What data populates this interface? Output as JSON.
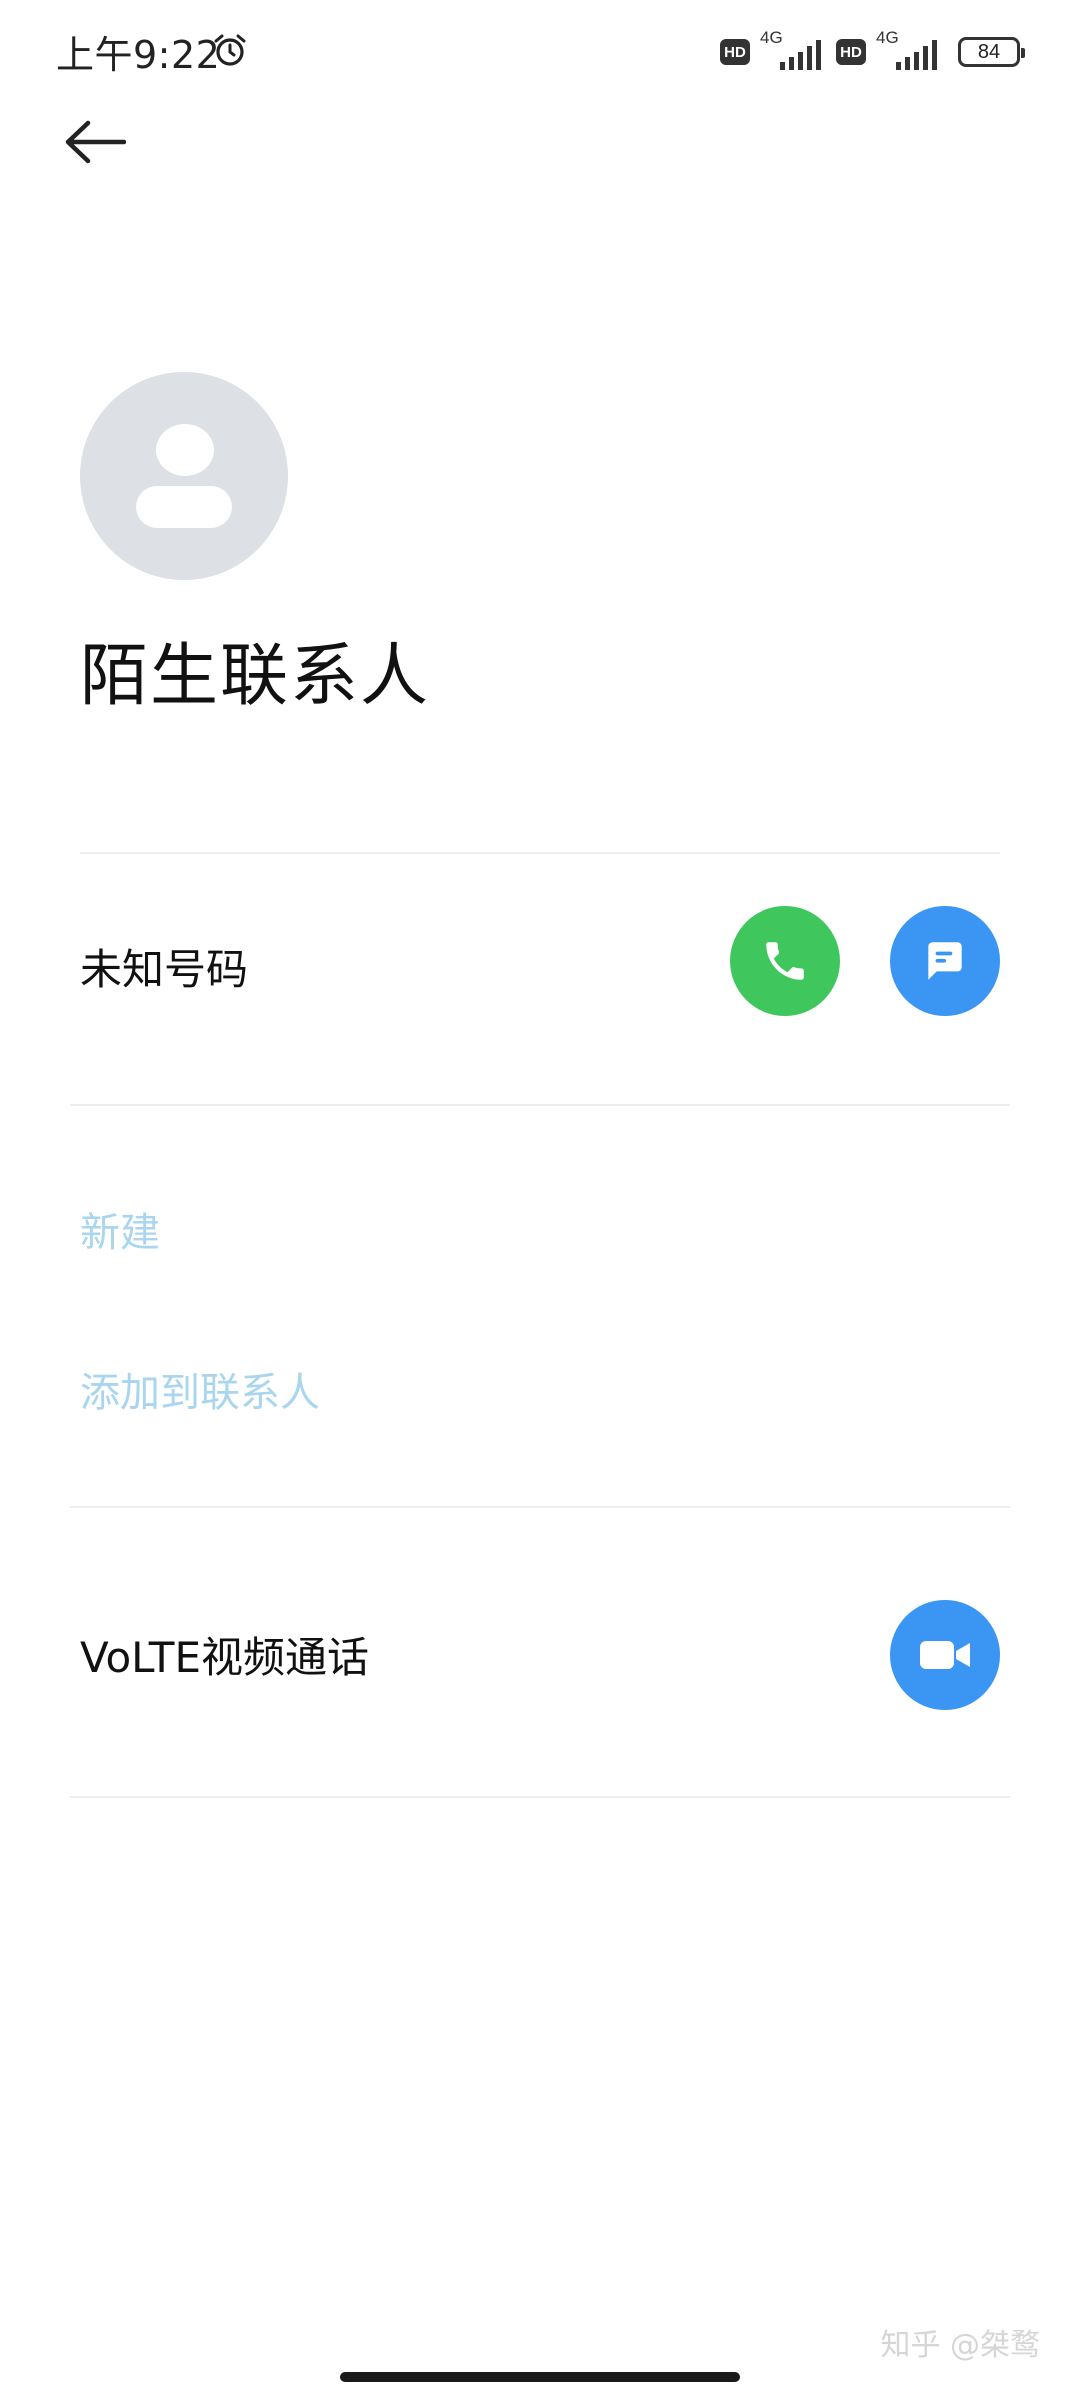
{
  "status_bar": {
    "time": "上午9:22",
    "hd_label": "HD",
    "sim1_network": "4G",
    "sim2_network": "4G",
    "battery": "84",
    "icons": [
      "alarm-icon",
      "signal-icon",
      "battery-icon"
    ]
  },
  "header": {
    "back_icon": "back-arrow-icon"
  },
  "contact": {
    "avatar_icon": "person-placeholder-icon",
    "name": "陌生联系人"
  },
  "number_row": {
    "label": "未知号码",
    "call_icon": "phone-icon",
    "message_icon": "message-icon"
  },
  "actions": {
    "new_label": "新建",
    "add_to_contacts_label": "添加到联系人"
  },
  "video_row": {
    "label": "VoLTE视频通话",
    "video_icon": "video-camera-icon"
  },
  "watermark": "知乎 @桀鹜",
  "colors": {
    "call_green": "#3fc75e",
    "action_blue": "#3b95f3",
    "link_light_blue": "#a9d5ee",
    "avatar_gray": "#dde0e4"
  }
}
